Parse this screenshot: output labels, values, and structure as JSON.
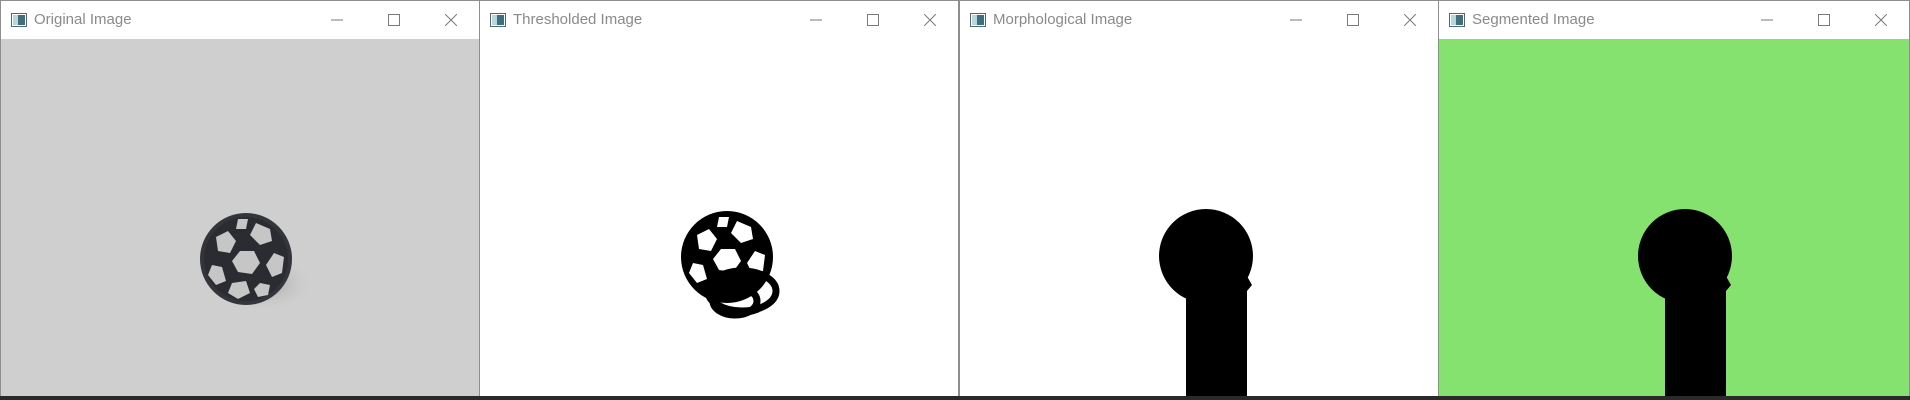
{
  "windows": [
    {
      "title": "Original Image",
      "icon": "image-viewer-icon",
      "background": "#cfcfcf"
    },
    {
      "title": "Thresholded Image",
      "icon": "image-viewer-icon",
      "background": "#ffffff"
    },
    {
      "title": "Morphological Image",
      "icon": "image-viewer-icon",
      "background": "#ffffff"
    },
    {
      "title": "Segmented Image",
      "icon": "image-viewer-icon",
      "background": "#86e26f"
    }
  ],
  "window_controls": {
    "minimize_icon": "minimize-icon",
    "maximize_icon": "maximize-icon",
    "close_icon": "close-icon"
  },
  "colors": {
    "title_text": "#8a8a8a",
    "object_black": "#000000",
    "ball_dark": "#2f3035",
    "segment_green": "#86e26f"
  }
}
